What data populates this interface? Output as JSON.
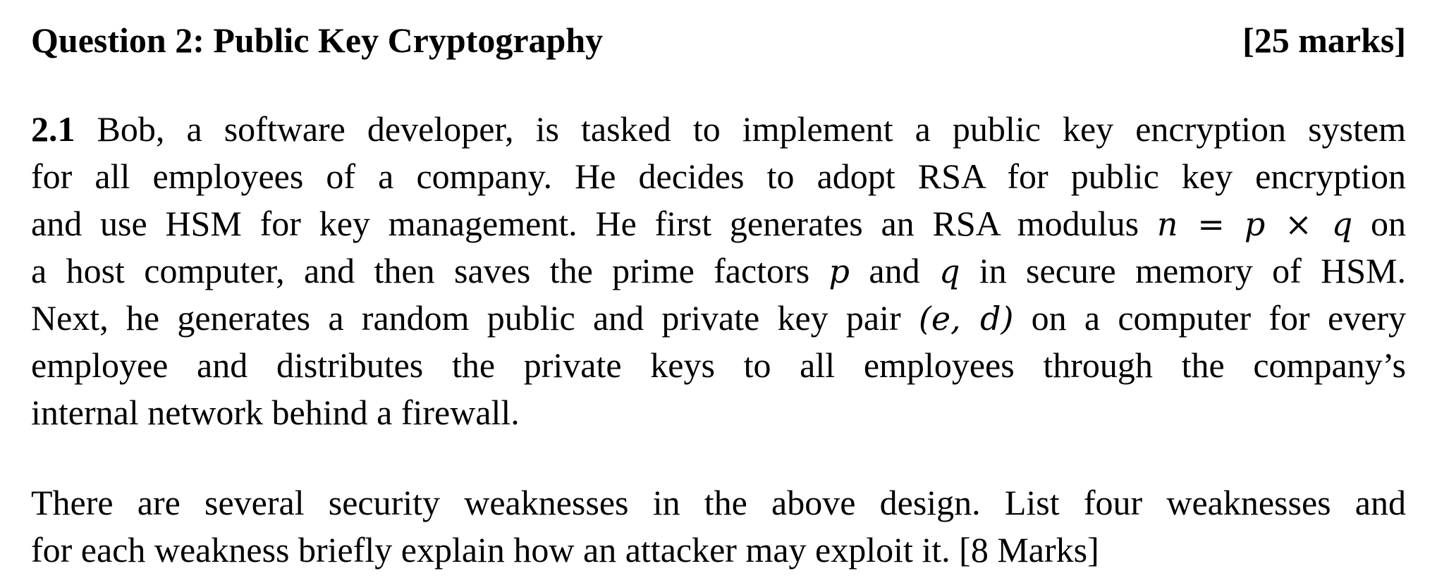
{
  "heading": {
    "title": "Question 2: Public Key Cryptography",
    "marks": "[25 marks]"
  },
  "q21": {
    "number": "2.1",
    "lines": [
      " Bob, a software developer, is tasked to implement a public key encryption system",
      "for all employees of a company. He decides to adopt RSA for public key encryption",
      "and use HSM for key management. He first generates an RSA modulus ",
      " on",
      "a host computer, and then saves the prime factors ",
      " and ",
      " in secure memory of HSM.",
      "Next, he generates a random public and private key pair ",
      " on a computer for every",
      "employee and distributes the private keys to all employees through the company’s",
      "internal network behind a firewall."
    ],
    "math": {
      "n": "n",
      "eq": " = ",
      "p": "p",
      "times": " × ",
      "q": "q",
      "p2": "p",
      "q2": "q",
      "pair": "(e, d)"
    }
  },
  "question_text": {
    "lines": [
      "There are several security weaknesses in the above design. List four weaknesses and",
      "for each weakness briefly explain how an attacker may exploit it. [8 Marks]"
    ]
  }
}
